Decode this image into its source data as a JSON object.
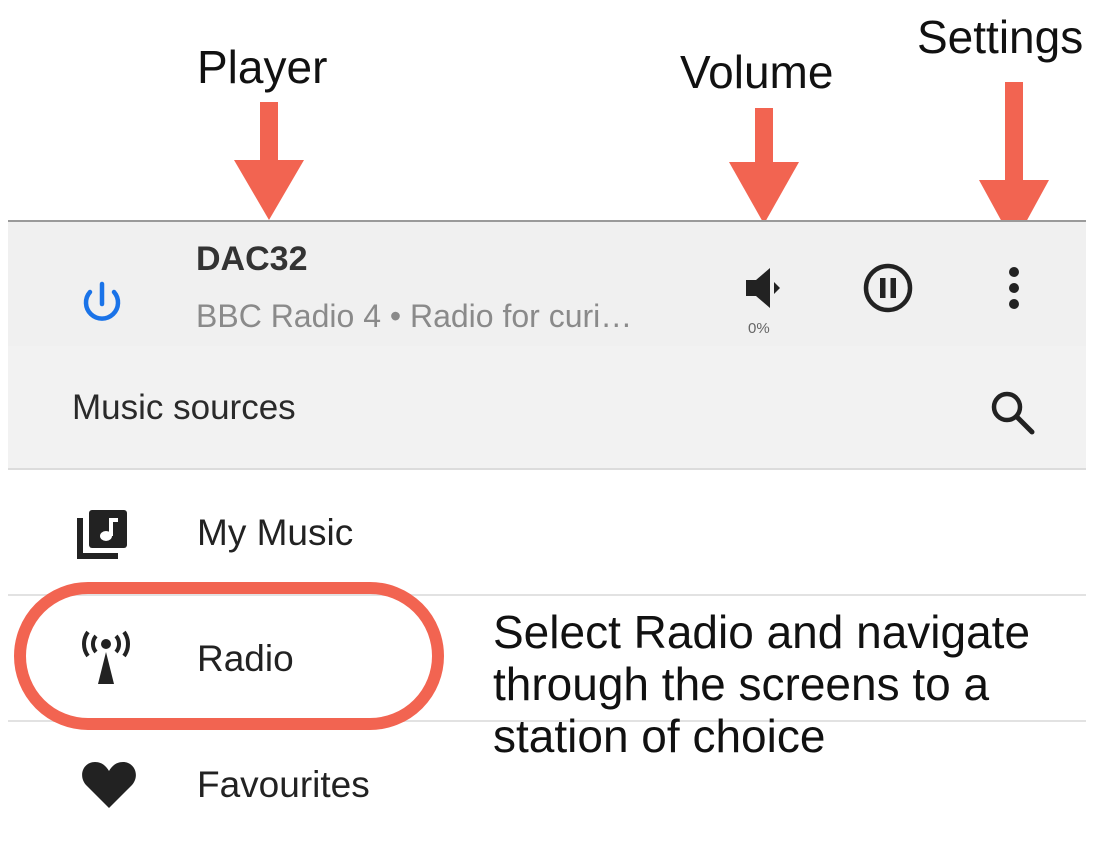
{
  "annotations": {
    "player": "Player",
    "volume": "Volume",
    "settings": "Settings",
    "callout_line1": "Select Radio and navigate",
    "callout_line2": "through the screens to a",
    "callout_line3": "station of choice"
  },
  "player": {
    "name": "DAC32",
    "now_playing": "BBC Radio 4 • Radio for curi…",
    "volume_percent": "0%",
    "power_color": "#1a73e8",
    "power_icon": "power-icon",
    "volume_icon": "volume-icon",
    "pause_icon": "pause-circle-icon",
    "settings_icon": "more-vert-icon"
  },
  "sources": {
    "title": "Music sources",
    "search_icon": "search-icon"
  },
  "list": [
    {
      "label": "My Music",
      "icon": "library-music-icon"
    },
    {
      "label": "Radio",
      "icon": "radio-tower-icon"
    },
    {
      "label": "Favourites",
      "icon": "heart-icon"
    }
  ],
  "colors": {
    "annotation_accent": "#f26451",
    "bar_background": "#f0f0f0"
  }
}
